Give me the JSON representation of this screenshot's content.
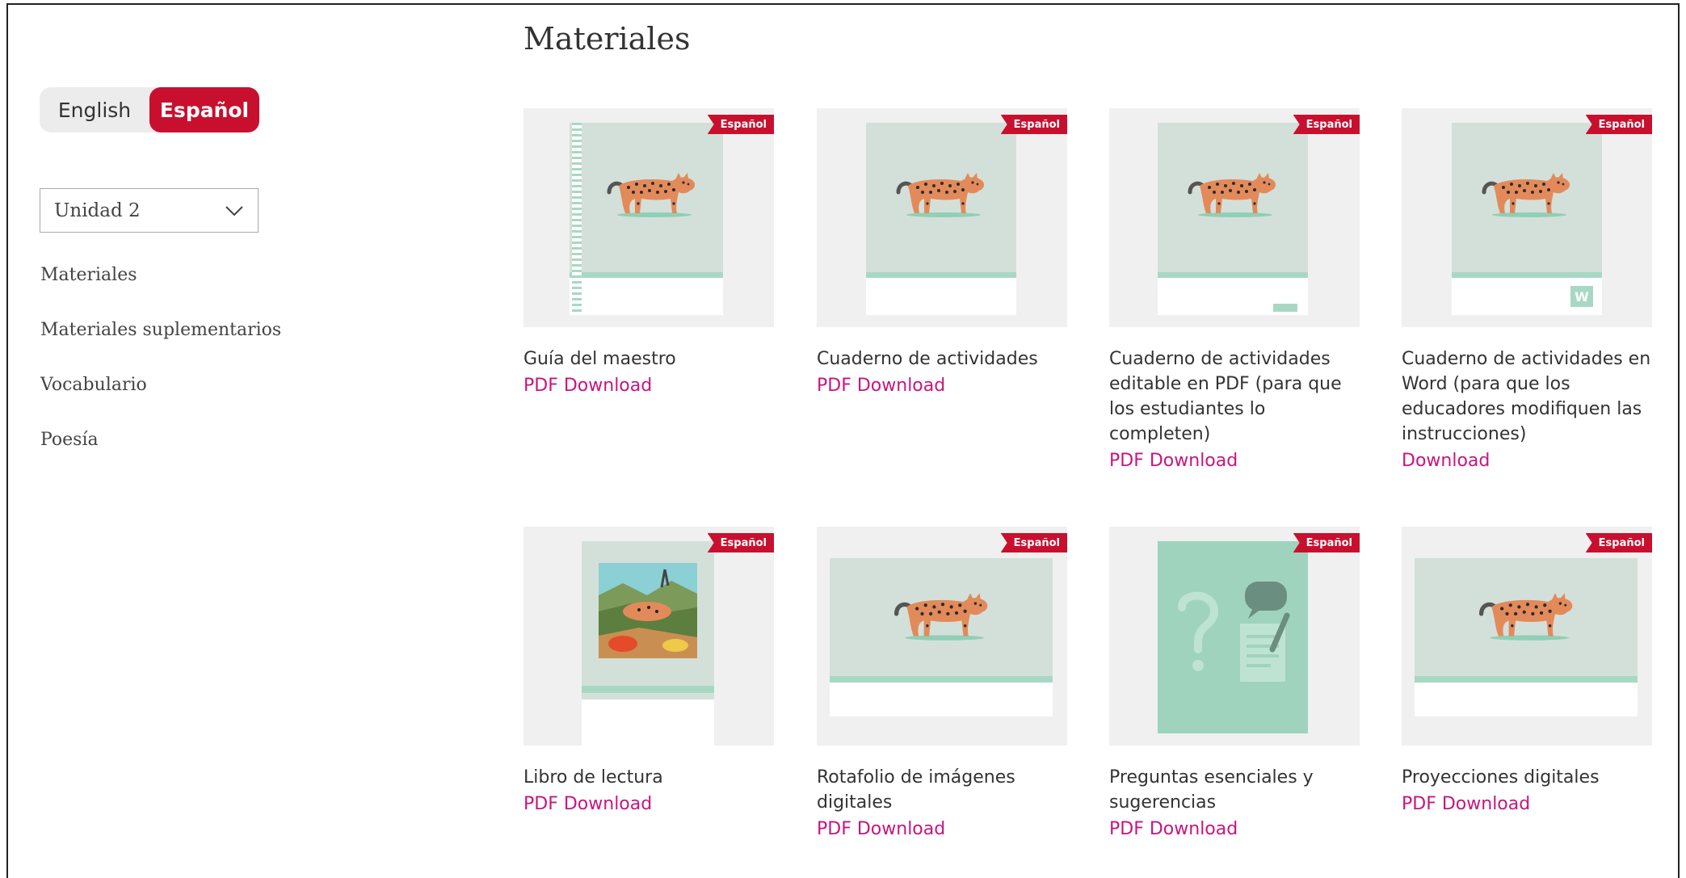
{
  "language": {
    "english": "English",
    "spanish": "Español",
    "active": "Español"
  },
  "unit_select": {
    "value": "Unidad 2"
  },
  "nav": [
    "Materiales",
    "Materiales suplementarios",
    "Vocabulario",
    "Poesía"
  ],
  "page_title": "Materiales",
  "badge_text": "Español",
  "colors": {
    "brand_red": "#c8102e",
    "link_magenta": "#c7157f",
    "cover_mint": "#d3e0d9",
    "cover_stripe": "#a8d8c4"
  },
  "materials": [
    {
      "title": "Guía del maestro",
      "link": "PDF Download",
      "cover": "teacher-guide-cover"
    },
    {
      "title": "Cuaderno de actividades",
      "link": "PDF Download",
      "cover": "activity-book-cover"
    },
    {
      "title": "Cuaderno de actividades editable en PDF (para que los estudiantes lo completen)",
      "link": "PDF Download",
      "cover": "editable-pdf-cover"
    },
    {
      "title": "Cuaderno de actividades en Word (para que los educadores modifiquen las instrucciones)",
      "link": "Download",
      "cover": "word-doc-cover",
      "word_badge": "W"
    },
    {
      "title": "Libro de lectura",
      "link": "PDF Download",
      "cover": "reader-cover"
    },
    {
      "title": "Rotafolio de imágenes digitales",
      "link": "PDF Download",
      "cover": "flip-book-cover"
    },
    {
      "title": "Preguntas esenciales y sugerencias",
      "link": "PDF Download",
      "cover": "questions-cover"
    },
    {
      "title": "Proyecciones digitales",
      "link": "PDF Download",
      "cover": "projections-cover"
    }
  ]
}
